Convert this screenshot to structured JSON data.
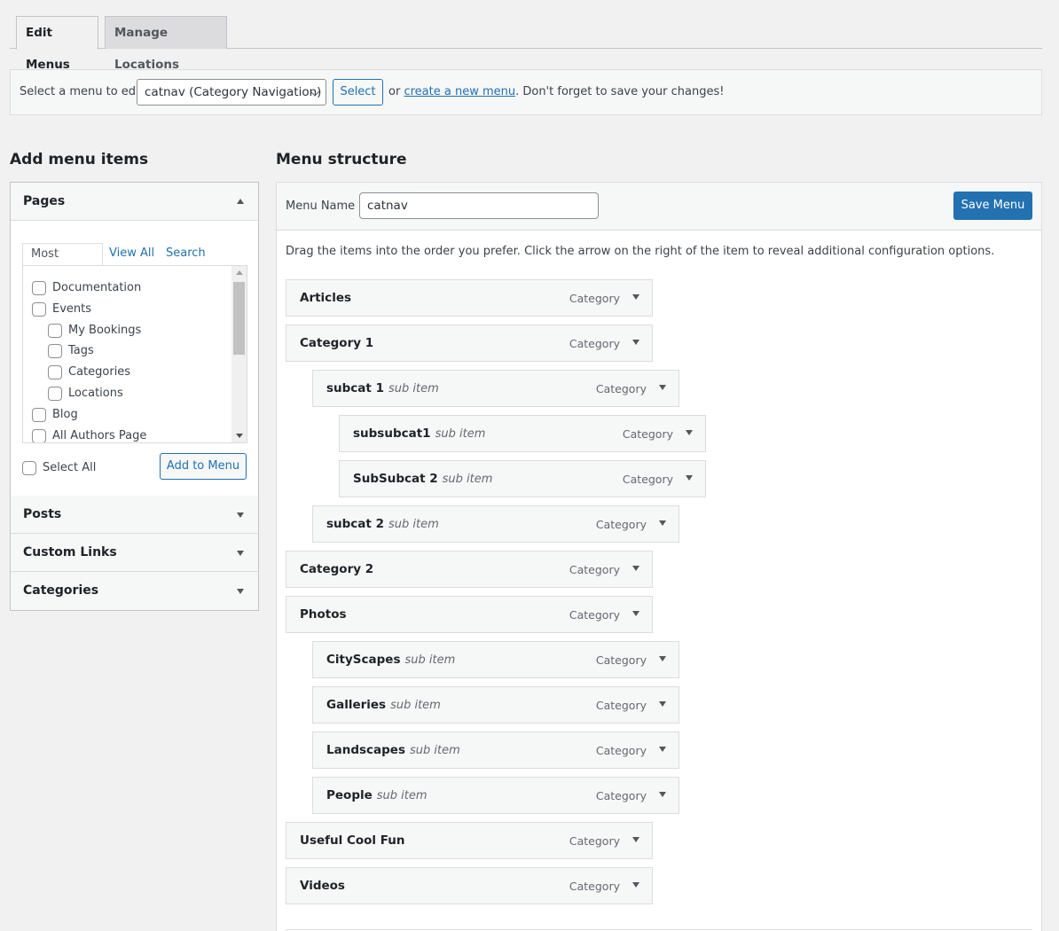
{
  "tabs": {
    "edit": "Edit Menus",
    "manage": "Manage Locations"
  },
  "select_bar": {
    "label": "Select a menu to edit:",
    "selected_menu": "catnav (Category Navigation)",
    "select_button": "Select",
    "or_text": "or",
    "create_link": "create a new menu",
    "suffix": ". Don't forget to save your changes!"
  },
  "left": {
    "heading": "Add menu items",
    "pages": {
      "title": "Pages",
      "subtabs": {
        "recent": "Most Recent",
        "all": "View All",
        "search": "Search"
      },
      "items": [
        {
          "label": "Documentation",
          "indent": 0
        },
        {
          "label": "Events",
          "indent": 0
        },
        {
          "label": "My Bookings",
          "indent": 1
        },
        {
          "label": "Tags",
          "indent": 1
        },
        {
          "label": "Categories",
          "indent": 1
        },
        {
          "label": "Locations",
          "indent": 1
        },
        {
          "label": "Blog",
          "indent": 0
        },
        {
          "label": "All Authors Page",
          "indent": 0
        }
      ],
      "select_all": "Select All",
      "add_button": "Add to Menu"
    },
    "sections": {
      "posts": "Posts",
      "links": "Custom Links",
      "categories": "Categories"
    }
  },
  "right": {
    "heading": "Menu structure",
    "menu_name_label": "Menu Name",
    "menu_name_value": "catnav",
    "save_button": "Save Menu",
    "instructions": "Drag the items into the order you prefer. Click the arrow on the right of the item to reveal additional configuration options.",
    "items": [
      {
        "title": "Articles",
        "sub": "",
        "type": "Category",
        "depth": 0
      },
      {
        "title": "Category 1",
        "sub": "",
        "type": "Category",
        "depth": 0
      },
      {
        "title": "subcat 1",
        "sub": "sub item",
        "type": "Category",
        "depth": 1
      },
      {
        "title": "subsubcat1",
        "sub": "sub item",
        "type": "Category",
        "depth": 2
      },
      {
        "title": "SubSubcat 2",
        "sub": "sub item",
        "type": "Category",
        "depth": 2
      },
      {
        "title": "subcat 2",
        "sub": "sub item",
        "type": "Category",
        "depth": 1
      },
      {
        "title": "Category 2",
        "sub": "",
        "type": "Category",
        "depth": 0
      },
      {
        "title": "Photos",
        "sub": "",
        "type": "Category",
        "depth": 0
      },
      {
        "title": "CityScapes",
        "sub": "sub item",
        "type": "Category",
        "depth": 1
      },
      {
        "title": "Galleries",
        "sub": "sub item",
        "type": "Category",
        "depth": 1
      },
      {
        "title": "Landscapes",
        "sub": "sub item",
        "type": "Category",
        "depth": 1
      },
      {
        "title": "People",
        "sub": "sub item",
        "type": "Category",
        "depth": 1
      },
      {
        "title": "Useful Cool Fun",
        "sub": "",
        "type": "Category",
        "depth": 0
      },
      {
        "title": "Videos",
        "sub": "",
        "type": "Category",
        "depth": 0
      }
    ]
  }
}
